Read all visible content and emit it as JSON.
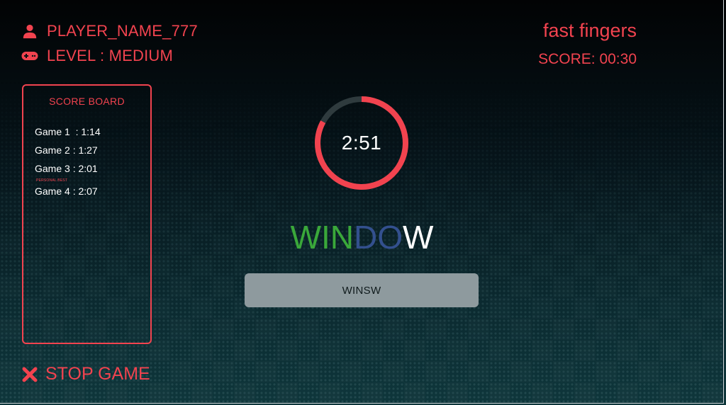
{
  "header": {
    "player_name": "PLAYER_NAME_777",
    "level": "LEVEL : MEDIUM",
    "player_icon": "user-icon",
    "level_icon": "gamepad-icon"
  },
  "brand": {
    "title": "fast fingers",
    "score": "SCORE: 00:30"
  },
  "scoreboard": {
    "title": "SCORE BOARD",
    "entries": [
      "Game 1  : 1:14",
      "Game 2 : 1:27",
      "Game 3 : 2:01",
      "Game 4 : 2:07"
    ],
    "badge": "PERSONAL BEST"
  },
  "timer": {
    "display": "2:51",
    "remaining_fraction": 0.83
  },
  "word": {
    "letters": [
      {
        "char": "W",
        "state": "correct"
      },
      {
        "char": "I",
        "state": "correct"
      },
      {
        "char": "N",
        "state": "correct"
      },
      {
        "char": "D",
        "state": "current"
      },
      {
        "char": "O",
        "state": "current"
      },
      {
        "char": "W",
        "state": "pending"
      }
    ]
  },
  "input": {
    "value": "WINSW"
  },
  "stop_button": {
    "label": "STOP GAME",
    "icon": "close-icon"
  },
  "colors": {
    "accent": "#f2434f",
    "correct": "#3aa83a",
    "current": "#33508e",
    "pending": "#ffffff",
    "ring_track": "#2f3b3e"
  }
}
